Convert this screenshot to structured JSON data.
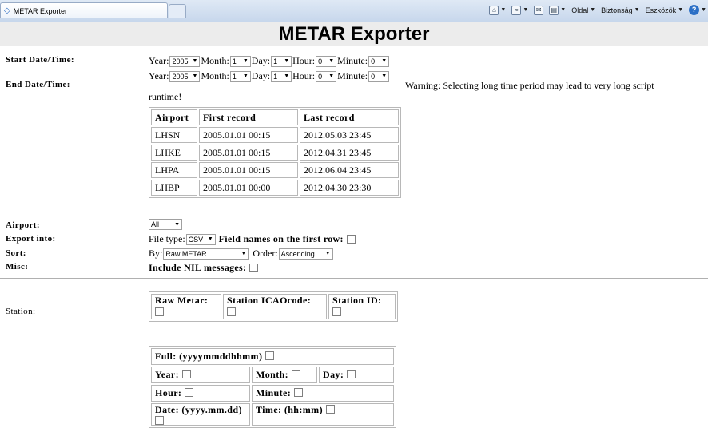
{
  "browser": {
    "tab_title": "METAR Exporter",
    "menu_page": "Oldal",
    "menu_security": "Biztonság",
    "menu_tools": "Eszközök"
  },
  "page": {
    "title": "METAR Exporter",
    "start_label": "Start Date/Time:",
    "end_label": "End Date/Time:",
    "year_label": "Year:",
    "month_label": "Month:",
    "day_label": "Day:",
    "hour_label": "Hour:",
    "minute_label": "Minute:",
    "start": {
      "year": "2005",
      "month": "1",
      "day": "1",
      "hour": "0",
      "minute": "0"
    },
    "end": {
      "year": "2005",
      "month": "1",
      "day": "1",
      "hour": "0",
      "minute": "0"
    },
    "warning": "Warning: Selecting long time period may lead to very long script",
    "warning_cont": "runtime!"
  },
  "airports_table": {
    "headers": [
      "Airport",
      "First record",
      "Last record"
    ],
    "rows": [
      [
        "LHSN",
        "2005.01.01 00:15",
        "2012.05.03 23:45"
      ],
      [
        "LHKE",
        "2005.01.01 00:15",
        "2012.04.31 23:45"
      ],
      [
        "LHPA",
        "2005.01.01 00:15",
        "2012.06.04 23:45"
      ],
      [
        "LHBP",
        "2005.01.01 00:00",
        "2012.04.30 23:30"
      ]
    ]
  },
  "options": {
    "airport_label": "Airport:",
    "airport_value": "All",
    "export_label": "Export into:",
    "filetype_label": "File type:",
    "filetype_value": "CSV",
    "fieldnames_label": "Field names on the first row:",
    "sort_label": "Sort:",
    "by_label": "By:",
    "by_value": "Raw METAR",
    "order_label": "Order:",
    "order_value": "Ascending",
    "misc_label": "Misc:",
    "nil_label": "Include NIL messages:"
  },
  "station": {
    "label": "Station:",
    "raw_metar": "Raw Metar:",
    "icao": "Station ICAOcode:",
    "station_id": "Station ID:"
  },
  "datetime": {
    "full": "Full: (yyyymmddhhmm)",
    "year": "Year:",
    "month": "Month:",
    "day": "Day:",
    "hour": "Hour:",
    "minute": "Minute:",
    "date": "Date: (yyyy.mm.dd)",
    "time": "Time: (hh:mm)"
  }
}
